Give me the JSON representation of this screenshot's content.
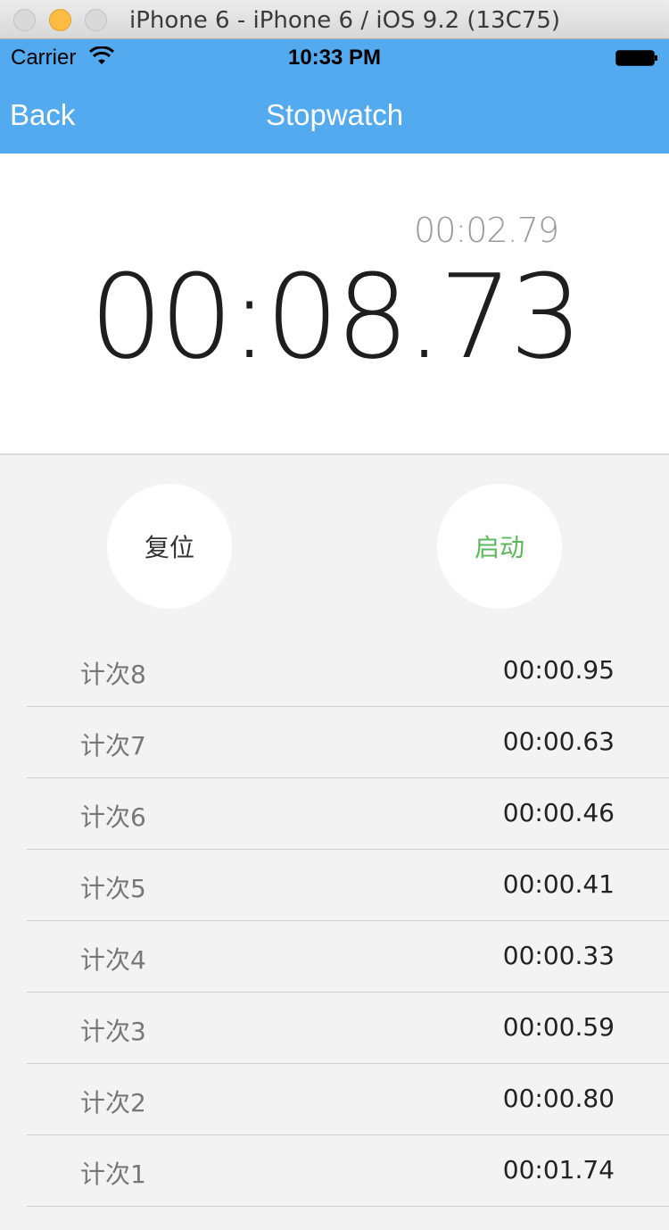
{
  "window": {
    "title": "iPhone 6 - iPhone 6 / iOS 9.2 (13C75)"
  },
  "status_bar": {
    "carrier": "Carrier",
    "time": "10:33 PM"
  },
  "nav": {
    "back_label": "Back",
    "title": "Stopwatch"
  },
  "timer": {
    "lap_time": "00:02.79",
    "total_time": "00:08.73"
  },
  "buttons": {
    "reset_label": "复位",
    "start_label": "启动"
  },
  "laps": [
    {
      "label": "计次8",
      "time": "00:00.95"
    },
    {
      "label": "计次7",
      "time": "00:00.63"
    },
    {
      "label": "计次6",
      "time": "00:00.46"
    },
    {
      "label": "计次5",
      "time": "00:00.41"
    },
    {
      "label": "计次4",
      "time": "00:00.33"
    },
    {
      "label": "计次3",
      "time": "00:00.59"
    },
    {
      "label": "计次2",
      "time": "00:00.80"
    },
    {
      "label": "计次1",
      "time": "00:01.74"
    }
  ],
  "colors": {
    "nav_background": "#54aaee",
    "start_button_text": "#5cb85c",
    "minimize_button": "#fdbc40"
  },
  "icons": {
    "wifi": "wifi-icon",
    "battery": "battery-icon"
  }
}
